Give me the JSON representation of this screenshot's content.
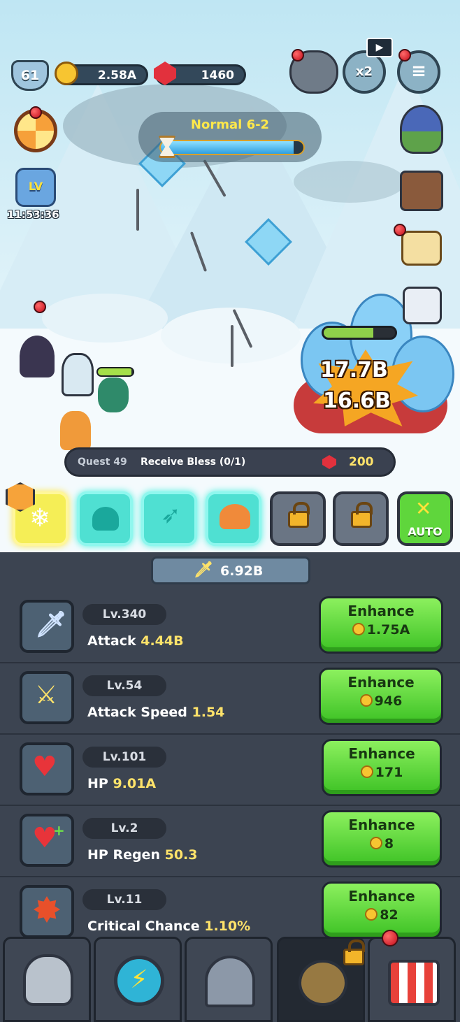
{
  "hud": {
    "player_level": "61",
    "gold": "2.58A",
    "gems": "1460",
    "speed_label": "x2",
    "timer": "11:53:36",
    "lv_badge": "LV"
  },
  "stage": {
    "mode": "Normal",
    "stage_number": "6-2",
    "progress": 0.93
  },
  "combat": {
    "damage_numbers": [
      "17.7B",
      "16.6B"
    ],
    "enemy_hp": 0.7,
    "hero_hp": 0.95
  },
  "quest": {
    "label": "Quest 49",
    "text": "Receive Bless (0/1)",
    "reward": "200"
  },
  "skills": {
    "auto_label": "AUTO"
  },
  "power": {
    "value": "6.92B"
  },
  "upgrades": [
    {
      "level": "Lv.340",
      "name": "Attack",
      "value": "4.44B",
      "button": "Enhance",
      "cost": "1.75A"
    },
    {
      "level": "Lv.54",
      "name": "Attack Speed",
      "value": "1.54",
      "button": "Enhance",
      "cost": "946"
    },
    {
      "level": "Lv.101",
      "name": "HP",
      "value": "9.01A",
      "button": "Enhance",
      "cost": "171"
    },
    {
      "level": "Lv.2",
      "name": "HP Regen",
      "value": "50.3",
      "button": "Enhance",
      "cost": "8"
    },
    {
      "level": "Lv.11",
      "name": "Critical Chance",
      "value": "1.10%",
      "button": "Enhance",
      "cost": "82"
    }
  ],
  "nav": [
    "helmet-icon",
    "energy-orb-icon",
    "gate-icon",
    "compass-icon",
    "shop-icon"
  ],
  "colors": {
    "enhance_green": "#5fd63c",
    "stat_value_yellow": "#ffe36a",
    "stage_title_yellow": "#ffe84a",
    "panel_bg": "#3c4451"
  }
}
